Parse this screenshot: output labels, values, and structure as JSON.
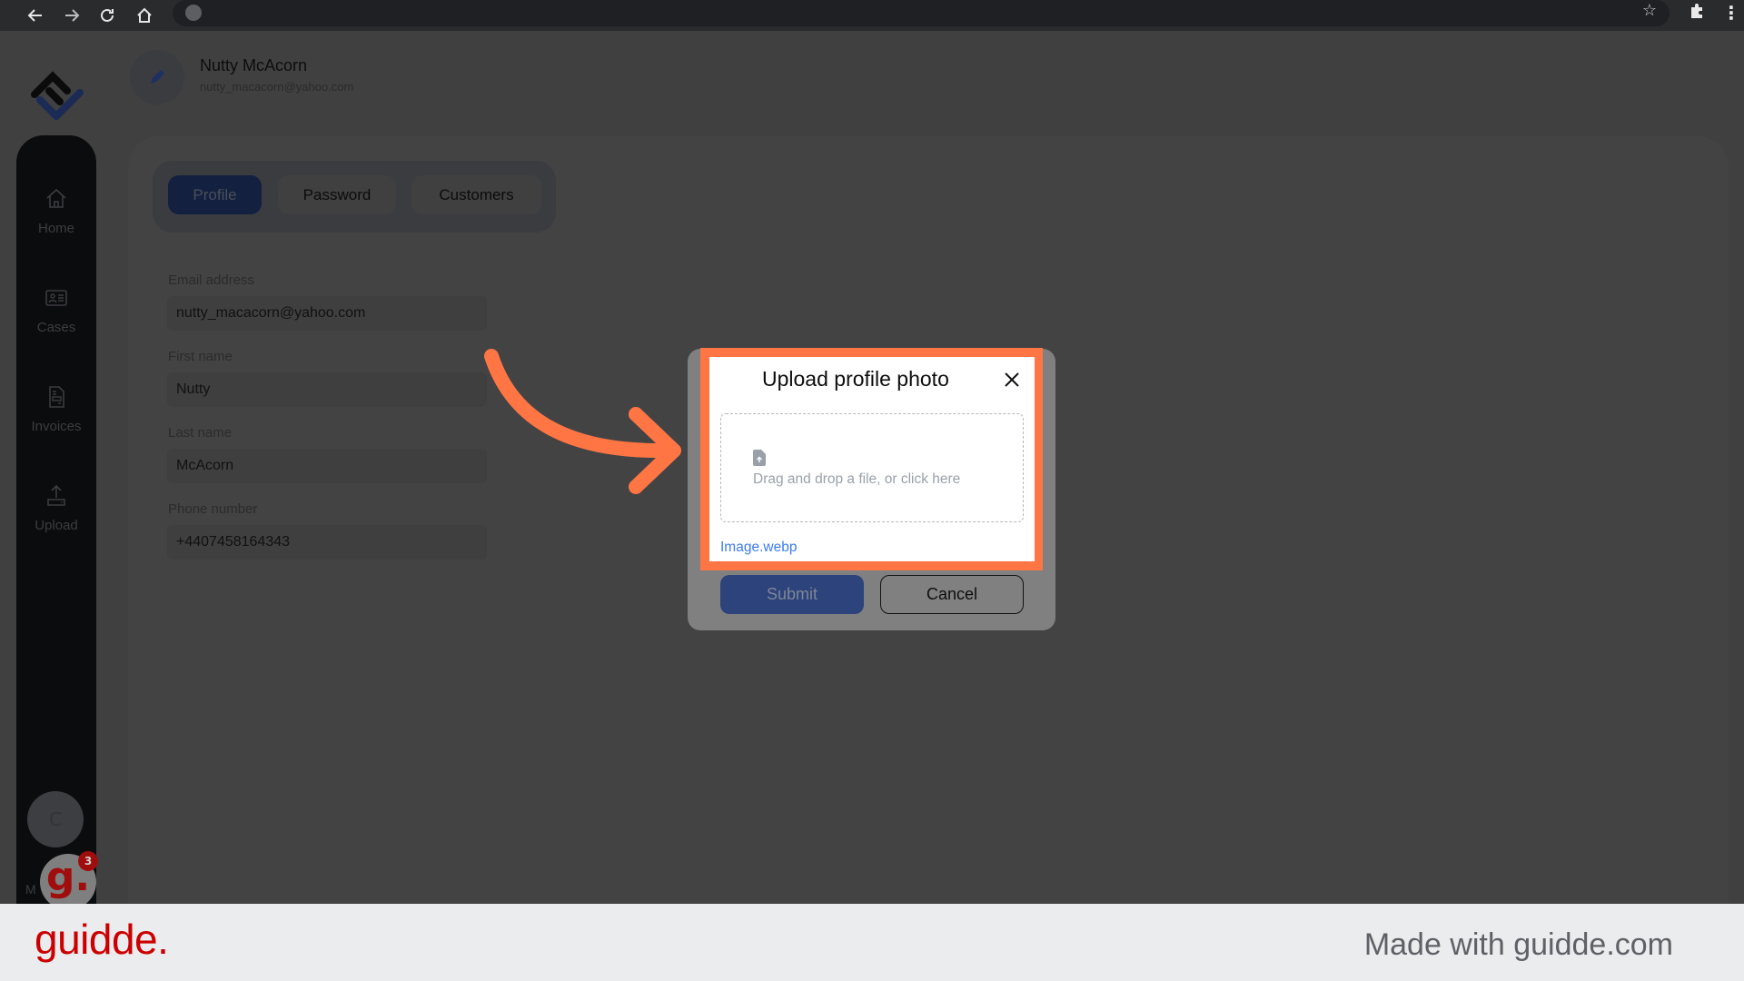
{
  "browser": {
    "back_icon": "arrow-left-icon",
    "forward_icon": "arrow-right-icon",
    "reload_icon": "reload-icon",
    "home_icon": "home-icon",
    "site_icon": "globe-icon",
    "bookmark_icon": "star-icon",
    "extensions_icon": "puzzle-icon",
    "menu_icon": "kebab-icon"
  },
  "header": {
    "name": "Nutty McAcorn",
    "email": "nutty_macacorn@yahoo.com",
    "avatar_icon": "pencil-icon"
  },
  "sidebar": {
    "items": [
      {
        "label": "Home",
        "icon": "home-icon"
      },
      {
        "label": "Cases",
        "icon": "id-card-icon"
      },
      {
        "label": "Invoices",
        "icon": "invoice-icon"
      },
      {
        "label": "Upload",
        "icon": "upload-icon"
      }
    ],
    "avatar_initial": "C",
    "bottom_label": "M"
  },
  "tabs": [
    {
      "label": "Profile",
      "active": true
    },
    {
      "label": "Password",
      "active": false
    },
    {
      "label": "Customers",
      "active": false
    }
  ],
  "form": {
    "fields": [
      {
        "label": "Email address",
        "value": "nutty_macacorn@yahoo.com"
      },
      {
        "label": "First name",
        "value": "Nutty"
      },
      {
        "label": "Last name",
        "value": "McAcorn"
      },
      {
        "label": "Phone number",
        "value": "+4407458164343"
      }
    ]
  },
  "modal": {
    "title": "Upload profile photo",
    "dropzone_text": "Drag and drop a file, or click here",
    "selected_file": "Image.webp",
    "submit_label": "Submit",
    "cancel_label": "Cancel"
  },
  "guidde": {
    "badge_letter": "g.",
    "notification_count": "3",
    "footer_brand": "guidde.",
    "footer_made_with": "Made with guidde.com"
  },
  "colors": {
    "accent_orange": "#ff7544",
    "primary_blue": "#2c437b",
    "link_blue": "#3b7bf0",
    "brand_red": "#cc0000"
  }
}
